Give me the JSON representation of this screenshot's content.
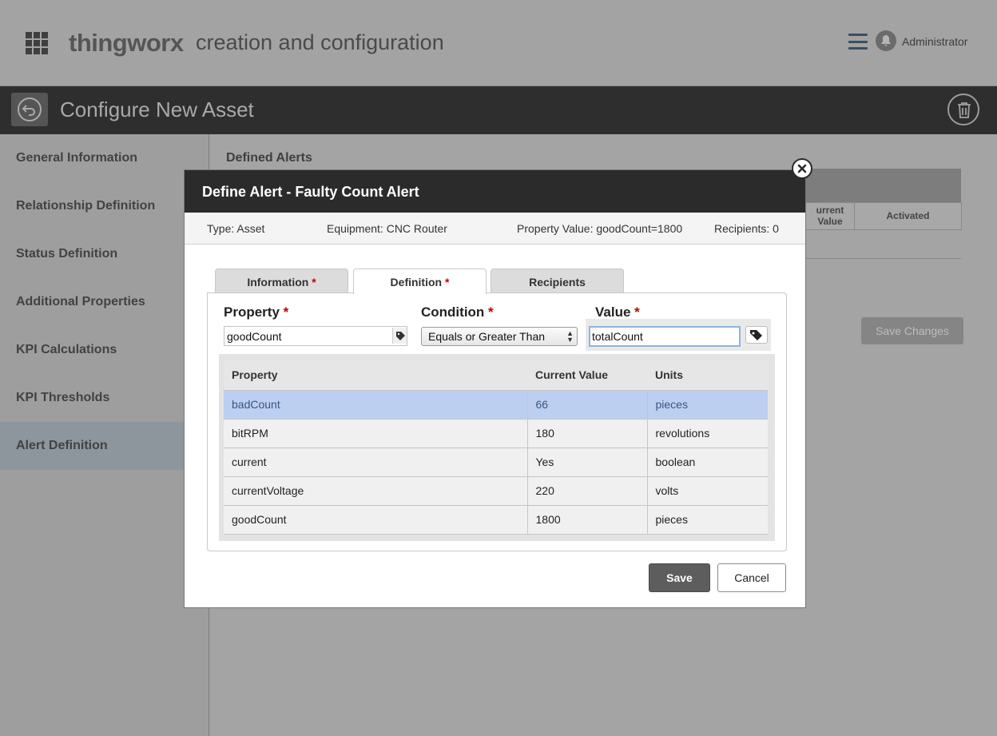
{
  "app": {
    "brand": "thingworx",
    "subtitle": "creation and configuration",
    "user_name": "Administrator",
    "page_title": "Configure New Asset"
  },
  "sidebar": {
    "items": [
      {
        "label": "General Information"
      },
      {
        "label": "Relationship Definition"
      },
      {
        "label": "Status Definition"
      },
      {
        "label": "Additional Properties"
      },
      {
        "label": "KPI Calculations"
      },
      {
        "label": "KPI Thresholds"
      },
      {
        "label": "Alert Definition",
        "active": true
      }
    ]
  },
  "background": {
    "section_title": "Defined Alerts",
    "col_current_value": "urrent Value",
    "col_activated": "Activated",
    "save_changes_label": "Save Changes"
  },
  "modal": {
    "title": "Define Alert  -  Faulty Count Alert",
    "info": {
      "type": "Type: Asset",
      "equipment": "Equipment: CNC Router",
      "property_value": "Property Value: goodCount=1800",
      "recipients": "Recipients: 0"
    },
    "tabs": [
      {
        "label": "Information",
        "required": "*"
      },
      {
        "label": "Definition",
        "required": "*",
        "active": true
      },
      {
        "label": "Recipients"
      }
    ],
    "fields": {
      "property_label": "Property",
      "property_value": "goodCount",
      "condition_label": "Condition",
      "condition_value": "Equals or Greater Than",
      "value_label": "Value",
      "value_value": "totalCount",
      "required_mark": "*"
    },
    "table": {
      "headers": [
        "Property",
        "Current Value",
        "Units"
      ],
      "rows": [
        {
          "property": "badCount",
          "value": "66",
          "units": "pieces",
          "selected": true
        },
        {
          "property": "bitRPM",
          "value": "180",
          "units": "revolutions"
        },
        {
          "property": "current",
          "value": "Yes",
          "units": "boolean"
        },
        {
          "property": "currentVoltage",
          "value": "220",
          "units": "volts"
        },
        {
          "property": "goodCount",
          "value": "1800",
          "units": "pieces"
        }
      ]
    },
    "save_label": "Save",
    "cancel_label": "Cancel"
  },
  "colors": {
    "header_dark": "#2b2b2b",
    "selected_row": "#bccff0",
    "required": "#c00000",
    "overlay_gray": "#9e9e9e"
  },
  "icons": [
    "apps-grid-icon",
    "menu-icon",
    "bell-icon",
    "back-icon",
    "trash-icon",
    "close-icon",
    "tag-icon",
    "dropdown-arrows-icon"
  ]
}
